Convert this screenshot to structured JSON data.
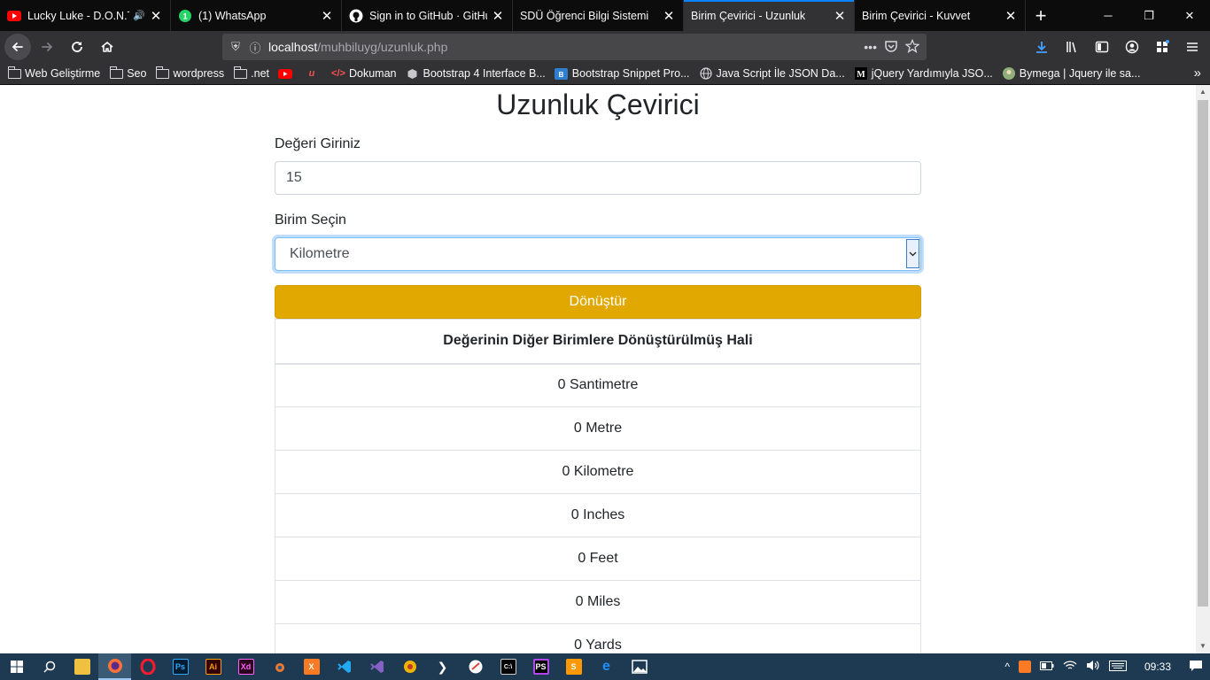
{
  "browser": {
    "tabs": [
      {
        "title": "Lucky Luke - D.O.N.T.",
        "icon": "youtube-icon",
        "audio": true
      },
      {
        "title": "(1) WhatsApp",
        "icon": "whatsapp-icon"
      },
      {
        "title": "Sign in to GitHub · GitHub",
        "icon": "github-icon"
      },
      {
        "title": "SDÜ Öğrenci Bilgi Sistemi",
        "icon": ""
      },
      {
        "title": "Birim Çevirici - Uzunluk",
        "icon": "",
        "active": true
      },
      {
        "title": "Birim Çevirici - Kuvvet",
        "icon": ""
      }
    ],
    "url_host": "localhost",
    "url_path": "/muhbiluyg/uzunluk.php",
    "url_more": "•••",
    "bookmarks": [
      {
        "label": "Web Geliştirme",
        "icon": "folder-icon"
      },
      {
        "label": "Seo",
        "icon": "folder-icon"
      },
      {
        "label": "wordpress",
        "icon": "folder-icon"
      },
      {
        "label": ".net",
        "icon": "folder-icon"
      },
      {
        "label": "",
        "icon": "youtube-icon"
      },
      {
        "label": "",
        "icon": "udemy-icon"
      },
      {
        "label": "Dokuman",
        "icon": "code-icon"
      },
      {
        "label": "Bootstrap 4 Interface B...",
        "icon": "box-icon"
      },
      {
        "label": "Bootstrap Snippet Pro...",
        "icon": "bootstrap-icon"
      },
      {
        "label": "Java Script İle JSON Da...",
        "icon": "globe-icon"
      },
      {
        "label": "jQuery Yardımıyla JSO...",
        "icon": "medium-icon"
      },
      {
        "label": "Bymega | Jquery ile sa...",
        "icon": "avatar-icon"
      }
    ]
  },
  "page": {
    "title": "Uzunluk Çevirici",
    "value_label": "Değeri Giriniz",
    "value_input": "15",
    "unit_label": "Birim Seçin",
    "unit_selected": "Kilometre",
    "convert_button": "Dönüştür",
    "table_header": "Değerinin Diğer Birimlere Dönüştürülmüş Hali",
    "results": [
      "0 Santimetre",
      "0 Metre",
      "0 Kilometre",
      "0 Inches",
      "0 Feet",
      "0 Miles",
      "0 Yards"
    ]
  },
  "taskbar": {
    "clock": "09:33"
  },
  "colors": {
    "button": "#e0a800",
    "focus_border": "#80bdff",
    "browser_dark": "#0c0c0d",
    "taskbar": "#1e3a52"
  }
}
